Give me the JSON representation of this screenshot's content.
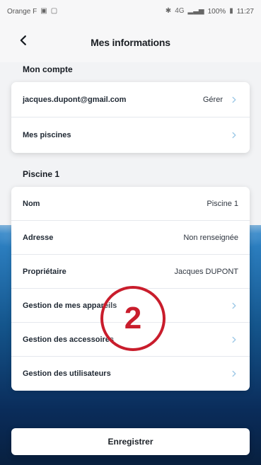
{
  "status_bar": {
    "carrier": "Orange F",
    "left_icons": [
      "message-icon",
      "gallery-icon"
    ],
    "bluetooth": "✱",
    "network": "4G",
    "signal": "",
    "battery_percent": "100%",
    "battery_icon": "battery-icon",
    "time": "11:27"
  },
  "header": {
    "title": "Mes informations",
    "back_icon": "chevron-left-icon"
  },
  "account": {
    "section_title": "Mon compte",
    "rows": [
      {
        "label": "jacques.dupont@gmail.com",
        "value": "Gérer",
        "has_chevron": true
      },
      {
        "label": "Mes piscines",
        "value": "",
        "has_chevron": true
      }
    ]
  },
  "pool": {
    "section_title": "Piscine 1",
    "rows": [
      {
        "label": "Nom",
        "value": "Piscine 1",
        "has_chevron": false
      },
      {
        "label": "Adresse",
        "value": "Non renseignée",
        "has_chevron": false
      },
      {
        "label": "Propriétaire",
        "value": "Jacques DUPONT",
        "has_chevron": false
      },
      {
        "label": "Gestion de mes appareils",
        "value": "",
        "has_chevron": true
      },
      {
        "label": "Gestion des accessoires",
        "value": "",
        "has_chevron": true
      },
      {
        "label": "Gestion des utilisateurs",
        "value": "",
        "has_chevron": true
      }
    ]
  },
  "annotation": {
    "step": "2",
    "color": "#c91d2c"
  },
  "footer": {
    "save_label": "Enregistrer"
  },
  "colors": {
    "chevron": "#9ec9e7",
    "title": "#1b1f24",
    "pool_gradient_top": "#2f84c7",
    "pool_gradient_bottom": "#08203f"
  }
}
